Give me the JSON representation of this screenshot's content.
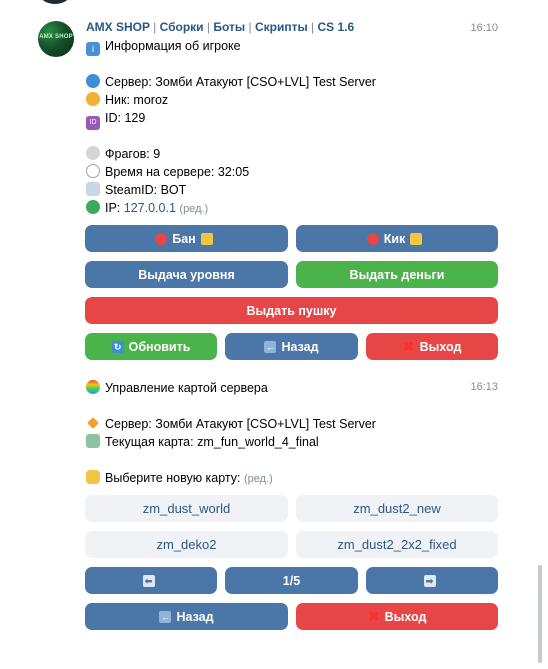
{
  "message1": {
    "sender": "AMX SHOP",
    "channels": [
      "Сборки",
      "Боты",
      "Скрипты",
      "CS 1.6"
    ],
    "time": "16:10",
    "avatar_text": "AMX SHOP",
    "title": "Информация об игроке",
    "server": "Сервер: Зомби Атакуют [CSO+LVL] Test Server",
    "nick": "Ник: moroz",
    "id": "ID: 129",
    "frags": "Фрагов: 9",
    "time_on_server": "Время на сервере: 32:05",
    "steamid": "SteamID: BOT",
    "ip_label": "IP:",
    "ip_value": "127.0.0.1",
    "edited": "(ред.)",
    "buttons": {
      "ban": "Бан",
      "kick": "Кик",
      "give_level": "Выдача уровня",
      "give_money": "Выдать деньги",
      "give_gun": "Выдать пушку",
      "refresh": "Обновить",
      "back": "Назад",
      "exit": "Выход"
    }
  },
  "message2": {
    "time": "16:13",
    "title": "Управление картой сервера",
    "server": "Сервер: Зомби Атакуют [CSO+LVL] Test Server",
    "current_map": "Текущая карта: zm_fun_world_4_final",
    "choose": "Выберите новую карту:",
    "edited": "(ред.)",
    "maps": [
      "zm_dust_world",
      "zm_dust2_new",
      "zm_deko2",
      "zm_dust2_2x2_fixed"
    ],
    "pagination": {
      "prev": "⬅",
      "page": "1/5",
      "next": "➡"
    },
    "buttons": {
      "back": "Назад",
      "exit": "Выход"
    }
  },
  "icons": {
    "info": "info-icon",
    "globe": "globe-icon",
    "cat": "cat-icon",
    "id": "id-icon",
    "skull": "skull-icon",
    "stopwatch": "stopwatch-icon",
    "dna": "dna-icon",
    "earth": "earth-icon",
    "rainbow": "rainbow-icon",
    "diamond": "diamond-icon",
    "map": "map-icon",
    "point": "point-icon",
    "no-entry": "no-entry-icon",
    "lock": "lock-icon",
    "walk": "walk-icon",
    "refresh": "refresh-icon",
    "back-arrow": "back-arrow-icon",
    "cross": "cross-icon"
  },
  "colors": {
    "link": "#2a5885",
    "blue": "#4a76a8",
    "green": "#4bb34b",
    "red": "#e64646",
    "gray": "#f0f2f5"
  }
}
